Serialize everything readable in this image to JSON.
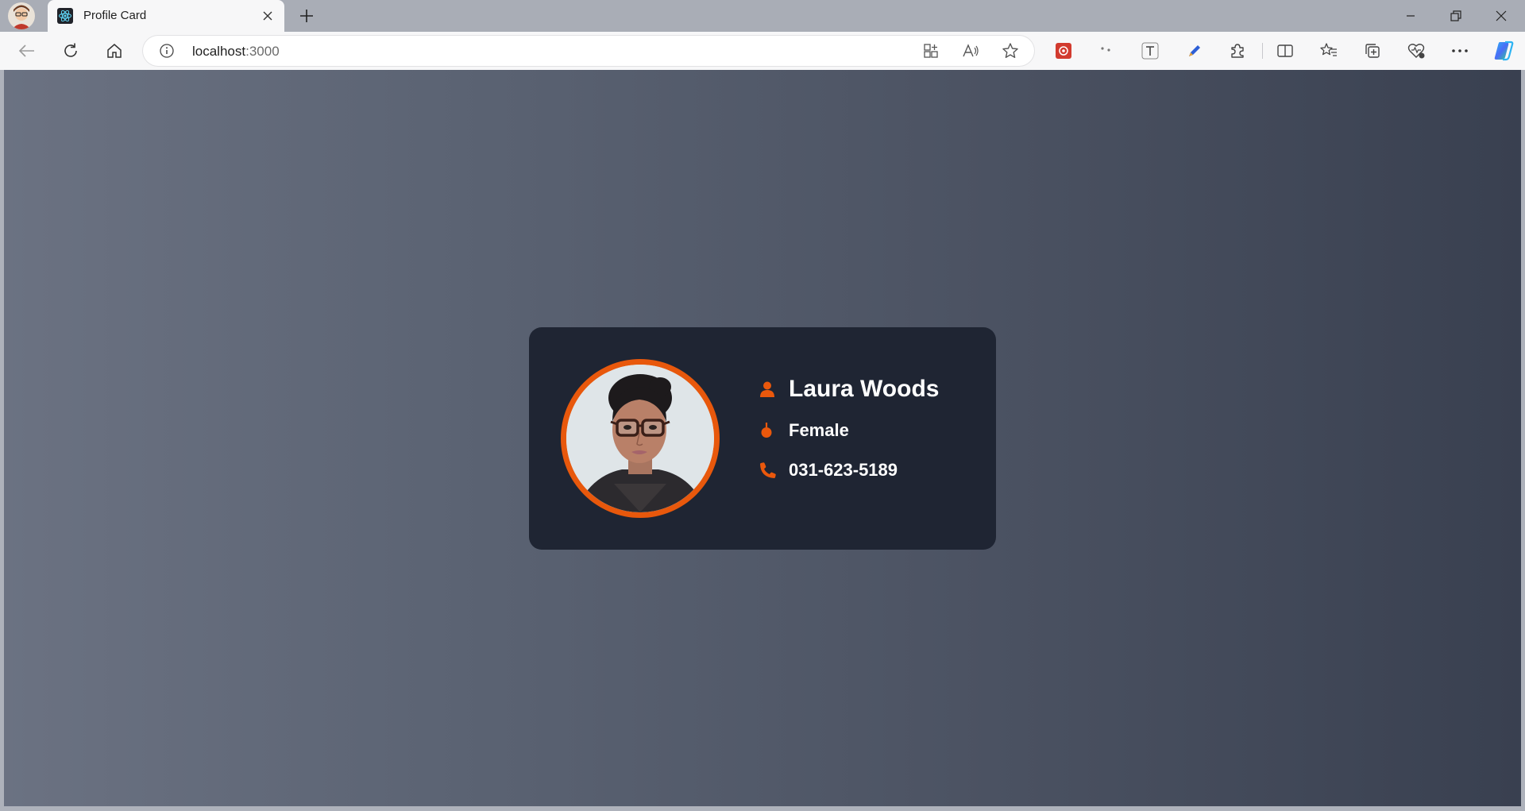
{
  "browser": {
    "tab": {
      "title": "Profile Card",
      "favicon": "react-logo-icon"
    },
    "address": {
      "host": "localhost",
      "port": ":3000"
    }
  },
  "profile": {
    "name": "Laura Woods",
    "gender": "Female",
    "phone": "031-623-5189",
    "colors": {
      "accent": "#ea580c",
      "card": "#1f2533",
      "text": "#ffffff"
    }
  }
}
